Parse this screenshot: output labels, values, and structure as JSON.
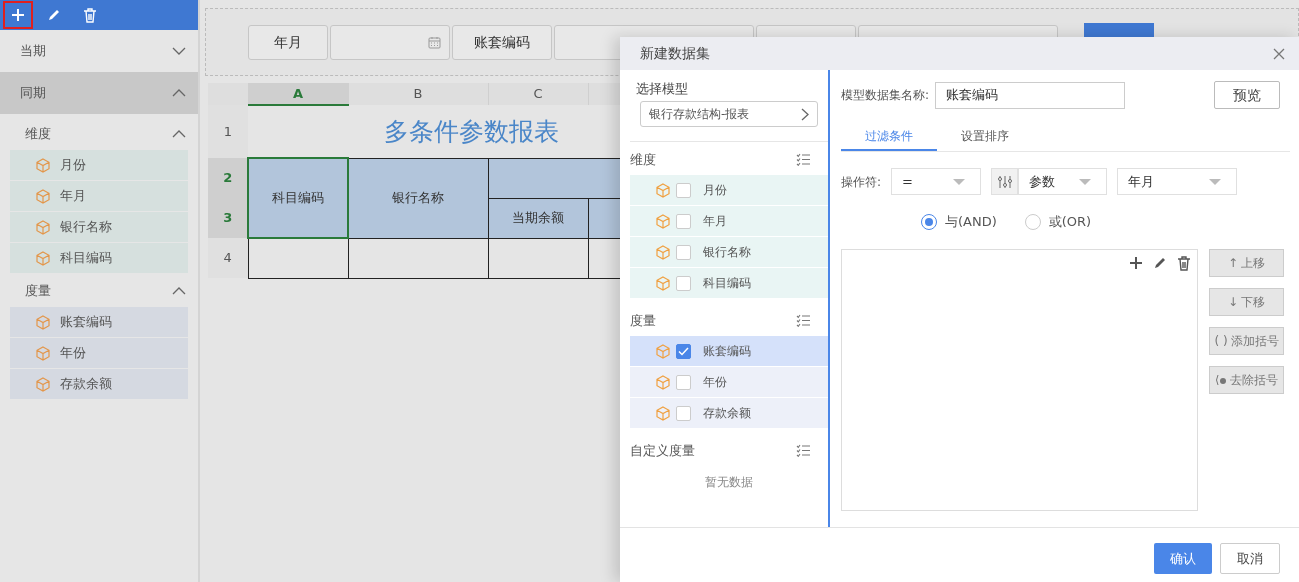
{
  "toolbar": [
    {
      "kind": "add",
      "selected": true
    },
    {
      "kind": "edit",
      "selected": false
    },
    {
      "kind": "delete",
      "selected": false
    }
  ],
  "sidebar": {
    "sections": [
      {
        "title": "当期",
        "expanded": false
      },
      {
        "title": "同期",
        "expanded": true,
        "groups": [
          {
            "title": "维度",
            "kind": "dimension",
            "expanded": true,
            "items": [
              "月份",
              "年月",
              "银行名称",
              "科目编码"
            ]
          },
          {
            "title": "度量",
            "kind": "measure",
            "expanded": true,
            "items": [
              "账套编码",
              "年份",
              "存款余额"
            ]
          }
        ]
      }
    ]
  },
  "filter_bar": [
    {
      "kind": "label",
      "text": "年月"
    },
    {
      "kind": "date"
    },
    {
      "kind": "label",
      "text": "账套编码"
    },
    {
      "kind": "field"
    },
    {
      "kind": "label"
    },
    {
      "kind": "field"
    },
    {
      "kind": "action"
    }
  ],
  "sheet": {
    "columns": [
      {
        "label": "A",
        "selected": true
      },
      {
        "label": "B",
        "selected": false
      },
      {
        "label": "C",
        "selected": false
      },
      {
        "selected": false
      }
    ],
    "rows": [
      {
        "label": "1",
        "selected": false
      },
      {
        "label": "2",
        "selected": true
      },
      {
        "label": "3",
        "selected": true
      },
      {
        "label": "4",
        "selected": false
      }
    ],
    "title": "多条件参数报表",
    "header_cells": [
      "科目编码",
      "银行名称"
    ],
    "sub_header": "当期余额"
  },
  "dialog": {
    "title": "新建数据集",
    "model": {
      "label": "选择模型",
      "value": "银行存款结构-报表"
    },
    "groups": [
      {
        "title": "维度",
        "kind": "dimension",
        "items": [
          {
            "label": "月份",
            "checked": false
          },
          {
            "label": "年月",
            "checked": false
          },
          {
            "label": "银行名称",
            "checked": false
          },
          {
            "label": "科目编码",
            "checked": false
          }
        ]
      },
      {
        "title": "度量",
        "kind": "measure",
        "items": [
          {
            "label": "账套编码",
            "checked": true
          },
          {
            "label": "年份",
            "checked": false
          },
          {
            "label": "存款余额",
            "checked": false
          }
        ]
      },
      {
        "title": "自定义度量",
        "kind": "custom",
        "empty_text": "暂无数据"
      }
    ],
    "name_label": "模型数据集名称:",
    "name_value": "账套编码",
    "preview": "预览",
    "tabs": [
      {
        "label": "过滤条件",
        "selected": true
      },
      {
        "label": "设置排序",
        "selected": false
      }
    ],
    "operator_label": "操作符:",
    "operator": "=",
    "source": "参数",
    "field": "年月",
    "logic": [
      {
        "label": "与(AND)",
        "selected": true
      },
      {
        "label": "或(OR)",
        "selected": false
      }
    ],
    "side_buttons": [
      {
        "kind": "up",
        "icon": "↑",
        "label": "上移"
      },
      {
        "kind": "down",
        "icon": "↓",
        "label": "下移"
      },
      {
        "kind": "add-bracket",
        "icon": "( )",
        "label": "添加括号"
      },
      {
        "kind": "remove-bracket",
        "label": "去除括号"
      }
    ],
    "confirm": "确认",
    "cancel": "取消"
  }
}
